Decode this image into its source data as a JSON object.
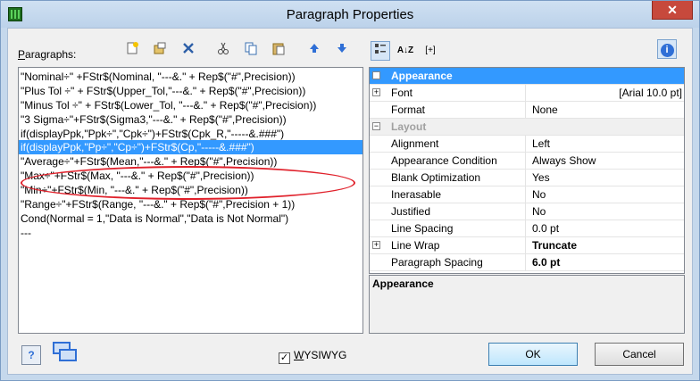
{
  "window": {
    "title": "Paragraph Properties",
    "close_label": "✕"
  },
  "paragraphs": {
    "label_accel": "P",
    "label_rest": "aragraphs:",
    "lines": [
      "\"Nominal÷\" +FStr$(Nominal, \"---&.\" + Rep$(\"#\",Precision))",
      "\"Plus Tol ÷\" + FStr$(Upper_Tol,\"---&.\" + Rep$(\"#\",Precision))",
      "\"Minus Tol ÷\" + FStr$(Lower_Tol, \"---&.\" + Rep$(\"#\",Precision))",
      "\"3 Sigma÷\"+FStr$(Sigma3,\"---&.\" + Rep$(\"#\",Precision))",
      "if(displayPpk,\"Ppk÷\",\"Cpk÷\")+FStr$(Cpk_R,\"-----&.###\")",
      "if(displayPpk,\"Pp÷\",\"Cp÷\")+FStr$(Cp,\"-----&.###\")",
      "\"Average÷\"+FStr$(Mean,\"---&.\" + Rep$(\"#\",Precision))",
      "\"Max÷\"+FStr$(Max, \"---&.\" + Rep$(\"#\",Precision))",
      "\"Min÷\"+FStr$(Min, \"---&.\" + Rep$(\"#\",Precision))",
      "\"Range÷\"+FStr$(Range, \"---&.\" + Rep$(\"#\",Precision + 1))",
      "Cond(Normal = 1,\"Data is Normal\",\"Data is Not Normal\")",
      "---"
    ],
    "selected_index": 5
  },
  "properties": {
    "rows": [
      {
        "type": "category",
        "name": "Appearance",
        "style": "appear",
        "exp": "−"
      },
      {
        "type": "prop",
        "name": "Font",
        "value": "[Arial 10.0 pt]",
        "exp": "+",
        "value_align": "right"
      },
      {
        "type": "prop",
        "name": "Format",
        "value": "None"
      },
      {
        "type": "category",
        "name": "Layout",
        "style": "layout",
        "exp": "−"
      },
      {
        "type": "prop",
        "name": "Alignment",
        "value": "Left"
      },
      {
        "type": "prop",
        "name": "Appearance Condition",
        "value": "Always Show"
      },
      {
        "type": "prop",
        "name": "Blank Optimization",
        "value": "Yes"
      },
      {
        "type": "prop",
        "name": "Inerasable",
        "value": "No"
      },
      {
        "type": "prop",
        "name": "Justified",
        "value": "No"
      },
      {
        "type": "prop",
        "name": "Line Spacing",
        "value": "0.0 pt"
      },
      {
        "type": "prop",
        "name": "Line Wrap",
        "value": "Truncate",
        "exp": "+",
        "bold": true
      },
      {
        "type": "prop",
        "name": "Paragraph Spacing",
        "value": "6.0 pt",
        "bold": true
      }
    ],
    "description_title": "Appearance"
  },
  "bottom": {
    "help_label": "?",
    "wysiwyg_accel": "W",
    "wysiwyg_rest": "YSIWYG",
    "wysiwyg_checked": "✓",
    "ok_label": "OK",
    "cancel_label": "Cancel"
  },
  "icons": {
    "sort_az": "A↓Z",
    "anchor": "[+]",
    "info": "i"
  },
  "colors": {
    "selection": "#3399ff",
    "highlight_ellipse": "#e0212b",
    "close_button": "#c7493c"
  }
}
